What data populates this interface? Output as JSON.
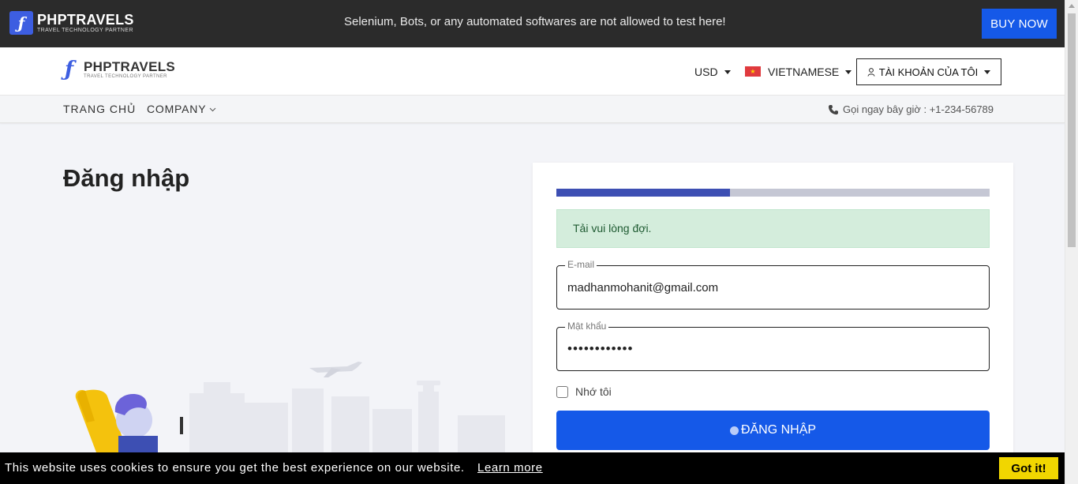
{
  "topbar": {
    "brand": "PHPTRAVELS",
    "tagline": "TRAVEL TECHNOLOGY PARTNER",
    "notice": "Selenium, Bots, or any automated softwares are not allowed to test here!",
    "buy_now": "BUY NOW"
  },
  "header": {
    "brand": "PHPTRAVELS",
    "tagline": "TRAVEL TECHNOLOGY PARTNER",
    "currency": "USD",
    "language": "VIETNAMESE",
    "account": "TÀI KHOẢN CỦA TÔI"
  },
  "nav": {
    "home": "TRANG CHỦ",
    "company": "COMPANY",
    "phone": "Gọi ngay bây giờ : +1-234-56789"
  },
  "main": {
    "title": "Đăng nhập"
  },
  "login": {
    "progress": 0.4,
    "alert": "Tải vui lòng đợi.",
    "email_label": "E-mail",
    "email_value": "madhanmohanit@gmail.com",
    "password_label": "Mật khẩu",
    "password_value": "123456789012",
    "remember_label": "Nhớ tôi",
    "submit": "ĐĂNG NHẬP"
  },
  "cookie": {
    "message": "This website uses cookies to ensure you get the best experience on our website.",
    "learn_more": "Learn more",
    "got_it": "Got it!"
  },
  "colors": {
    "accent": "#1559e8",
    "topbar_bg": "#2b2b2b",
    "alert_bg": "#d4eddc",
    "cookie_button": "#f1d600"
  }
}
